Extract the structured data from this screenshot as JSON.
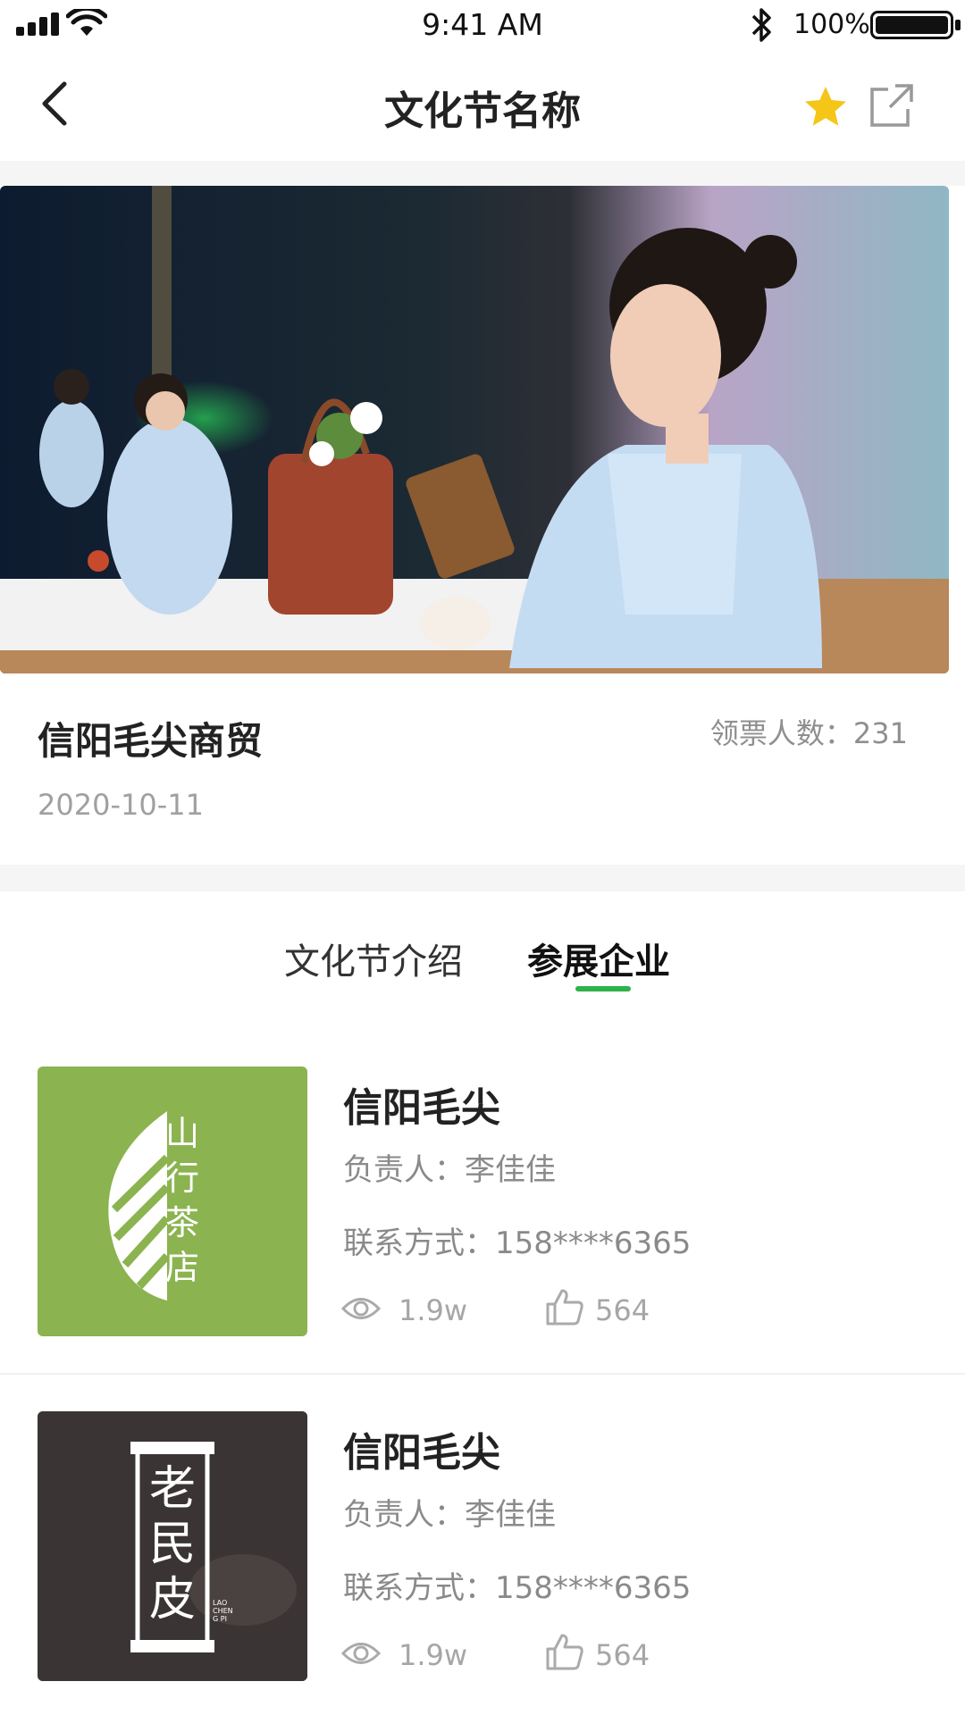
{
  "status_bar": {
    "time": "9:41 AM",
    "battery": "100%"
  },
  "nav": {
    "title": "文化节名称",
    "back_icon": "chevron-left-icon",
    "favorite_icon": "star-icon",
    "share_icon": "share-icon",
    "favorite_color": "#f5c518"
  },
  "event": {
    "name": "信阳毛尖商贸",
    "tickets_label": "领票人数：231",
    "date": "2020-10-11"
  },
  "tabs": [
    {
      "label": "文化节介绍",
      "active": false
    },
    {
      "label": "参展企业",
      "active": true
    }
  ],
  "accent_color": "#2db34a",
  "companies": [
    {
      "name": "信阳毛尖",
      "owner": "负责人：李佳佳",
      "contact": "联系方式：158****6365",
      "views": "1.9w",
      "likes": "564",
      "logo_text": "山行茶店",
      "logo_bg": "#8bb34f"
    },
    {
      "name": "信阳毛尖",
      "owner": "负责人：李佳佳",
      "contact": "联系方式：158****6365",
      "views": "1.9w",
      "likes": "564",
      "logo_text": "老民皮",
      "logo_sub": "LAO CHENG PI",
      "logo_bg": "#3a3534"
    }
  ]
}
